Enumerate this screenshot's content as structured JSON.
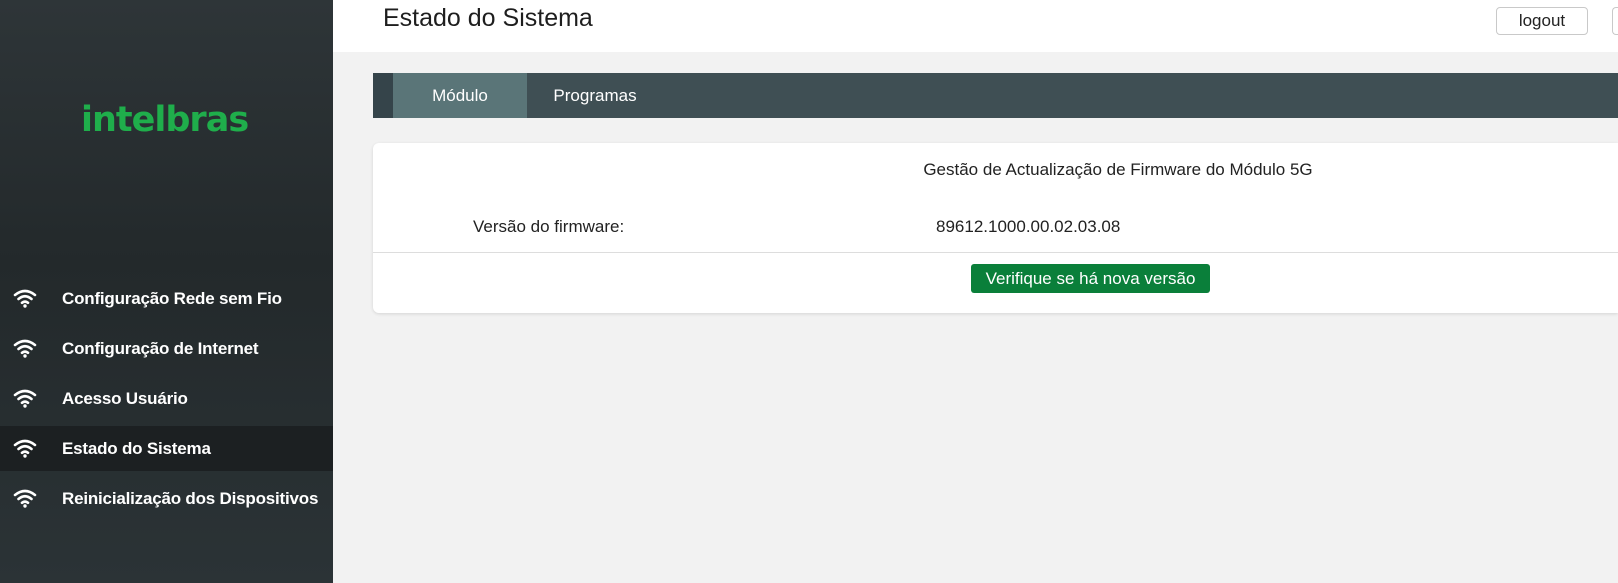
{
  "brand": {
    "logo_text": "intelbras",
    "logo_color": "#1fae4b"
  },
  "sidebar": {
    "items": [
      {
        "label": "Configuração Rede sem Fio",
        "icon": "wifi-icon",
        "active": false
      },
      {
        "label": "Configuração de Internet",
        "icon": "wifi-icon",
        "active": false
      },
      {
        "label": "Acesso Usuário",
        "icon": "wifi-icon",
        "active": false
      },
      {
        "label": "Estado do Sistema",
        "icon": "wifi-icon",
        "active": true
      },
      {
        "label": "Reinicialização dos Dispositivos",
        "icon": "wifi-icon",
        "active": false
      }
    ]
  },
  "header": {
    "title": "Estado do Sistema",
    "logout_label": "logout"
  },
  "tabs": [
    {
      "label": "Módulo",
      "active": true
    },
    {
      "label": "Programas",
      "active": false
    }
  ],
  "firmware_panel": {
    "title": "Gestão de Actualização de Firmware do Módulo 5G",
    "version_label": "Versão do firmware:",
    "version_value": "89612.1000.00.02.03.08",
    "check_button_label": "Verifique se há nova versão",
    "check_button_color": "#0a7f3a"
  },
  "colors": {
    "sidebar_bg": "#2b3336",
    "tabbar_bg": "#3f4f54",
    "tab_active_bg": "#5a7578",
    "page_bg": "#f2f2f2"
  }
}
